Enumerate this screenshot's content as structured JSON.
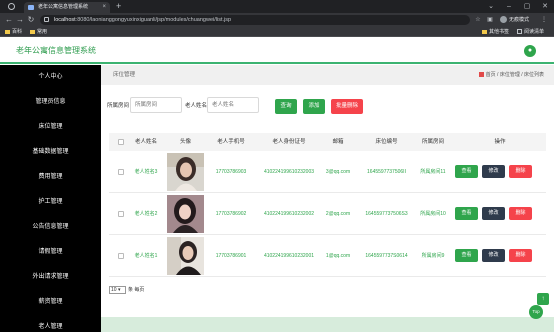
{
  "browser": {
    "tab_title": "老年公寓信息管理系统",
    "tab_close": "×",
    "new_tab": "+",
    "back": "←",
    "forward": "→",
    "reload": "↻",
    "url_host": "localhost",
    "url_rest": ":8080/laonianggongyuxinxiguanli/jsp/modules/chuangwei/list.jsp",
    "incognito_label": "无痕模式",
    "win_min": "–",
    "win_max": "▢",
    "win_close": "✕",
    "bookmarks": [
      "百科",
      "常用"
    ],
    "bookmarks_right": [
      "其他书签",
      "阅读清单"
    ]
  },
  "app": {
    "title": "老年公寓信息管理系统",
    "avatar_glyph": "👤",
    "accent_color": "#2fa54c"
  },
  "sidebar": {
    "items": [
      "个人中心",
      "管理员信息",
      "床位管理",
      "基础数据管理",
      "费用管理",
      "护工管理",
      "公告信息管理",
      "请假管理",
      "外出请求管理",
      "薪资管理",
      "老人管理"
    ]
  },
  "breadcrumb": {
    "title": "床位管理",
    "trail": "首页 / 床位管理 / 床位列表"
  },
  "search": {
    "room_label": "所属房间",
    "room_placeholder": "所属房间",
    "name_label": "老人姓名",
    "name_placeholder": "老人姓名",
    "query": "查询",
    "add": "添加",
    "batch_delete": "批量删除"
  },
  "table": {
    "headers": [
      "老人姓名",
      "头像",
      "老人手机号",
      "老人身份证号",
      "邮箱",
      "床位编号",
      "所属房间",
      "操作"
    ],
    "rows": [
      {
        "name": "老人姓名3",
        "phone": "17703786903",
        "idcard": "410224199610232003",
        "email": "3@qq.com",
        "bed": "1645597737506II",
        "room": "所属房间11"
      },
      {
        "name": "老人姓名2",
        "phone": "17703786902",
        "idcard": "410224199610232002",
        "email": "2@qq.com",
        "bed": "1645597737506S3",
        "room": "所属房间10"
      },
      {
        "name": "老人姓名1",
        "phone": "17703786901",
        "idcard": "410224199610232001",
        "email": "1@qq.com",
        "bed": "1645597737S0614",
        "room": "所属房间9"
      }
    ],
    "view": "查看",
    "edit": "修改",
    "delete": "删除"
  },
  "pager": {
    "per_page": "10",
    "suffix": "条 每页"
  },
  "floating": {
    "up": "↑",
    "top": "Top"
  },
  "icons": {
    "home": "home-icon",
    "lock": "lock-icon",
    "user": "user-icon"
  }
}
